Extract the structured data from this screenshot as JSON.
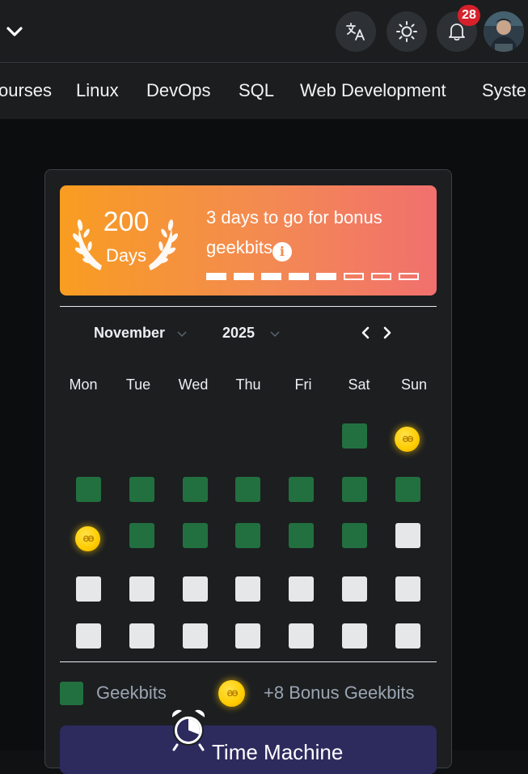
{
  "header": {
    "notifications_count": "28",
    "icons": [
      "chevron-down-icon",
      "translate-icon",
      "sun-icon",
      "bell-icon"
    ]
  },
  "nav": {
    "items": [
      "ourses",
      "Linux",
      "DevOps",
      "SQL",
      "Web Development",
      "Syste"
    ]
  },
  "streak": {
    "days_number": "200",
    "days_label": "Days",
    "bonus_text": "3 days to go for bonus geekbits",
    "progress_filled": 5,
    "progress_total": 8
  },
  "calendar": {
    "month": "November",
    "year": "2025",
    "weekdays": [
      "Mon",
      "Tue",
      "Wed",
      "Thu",
      "Fri",
      "Sat",
      "Sun"
    ],
    "weeks": [
      [
        "empty",
        "empty",
        "empty",
        "empty",
        "empty",
        "green",
        "coin"
      ],
      [
        "green",
        "green",
        "green",
        "green",
        "green",
        "green",
        "green"
      ],
      [
        "coin",
        "green",
        "green",
        "green",
        "green",
        "green",
        "white"
      ],
      [
        "white",
        "white",
        "white",
        "white",
        "white",
        "white",
        "white"
      ],
      [
        "white",
        "white",
        "white",
        "white",
        "white",
        "white",
        "white"
      ]
    ]
  },
  "legend": {
    "geekbits_label": "Geekbits",
    "bonus_label": "+8 Bonus Geekbits"
  },
  "time_machine": {
    "label": "Time Machine"
  },
  "colors": {
    "green": "#227040",
    "streak_start": "#f89d21",
    "streak_end": "#f1706e",
    "badge": "#d6202b",
    "coin": "#ffcc00",
    "time_button": "#2d2a5e"
  }
}
